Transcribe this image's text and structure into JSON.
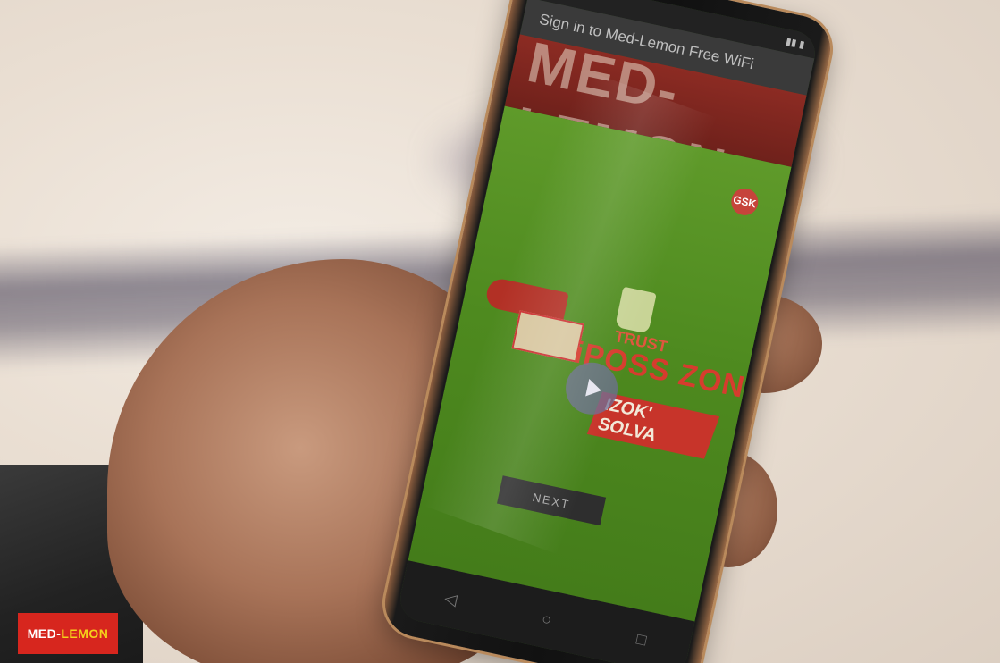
{
  "phone": {
    "wifi_title": "Sign in to Med-Lemon Free WiFi",
    "header_text": "MED-LEMON",
    "logo_badge": "GSK",
    "ad": {
      "trust": "TRUST",
      "title": "iPOSS ZONKE",
      "badge": "IZOK' SOLVA"
    },
    "next_label": "NEXT",
    "nav": {
      "back": "◁",
      "home": "○",
      "recent": "□"
    }
  },
  "watermark": {
    "part1": "MED-",
    "part2": "LEMON"
  },
  "colors": {
    "brand_red": "#d7261e",
    "lemon_yellow": "#f5d21b",
    "screen_green": "#5f9a2a"
  }
}
